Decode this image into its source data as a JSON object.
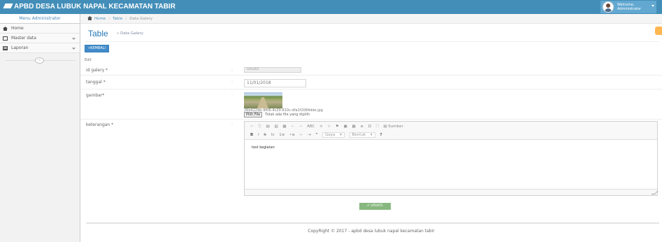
{
  "app": {
    "title": "APBD DESA LUBUK NAPAL KECAMATAN TABIR",
    "user": {
      "welcome": "Welcome,",
      "name": "Administrator"
    }
  },
  "sidebar": {
    "header": "Menu Administrator",
    "items": [
      {
        "label": "Home",
        "icon": "home-icon",
        "has_children": false
      },
      {
        "label": "Master data",
        "icon": "edit-icon",
        "has_children": true
      },
      {
        "label": "Laporan",
        "icon": "table-icon",
        "has_children": true
      }
    ],
    "collapse_symbol": "«"
  },
  "breadcrumb": [
    "Home",
    "Table",
    "Data Galery"
  ],
  "page": {
    "title": "Table",
    "subtitle": "» Data Galery",
    "back_button": "KEMBALI",
    "section_label": "Edit"
  },
  "form": {
    "id_label": "id galery *",
    "id_value": "GAL001",
    "date_label": "tanggal *",
    "date_value": "11/01/2018",
    "image_label": "gambar*",
    "image_filename": "26b4229b-9f06-4c20-810c-dfa1f2084dde.jpg",
    "file_button": "Pilih File",
    "file_status": "Tidak ada file yang dipilih",
    "desc_label": "keterangan *",
    "desc_value": "test kegiatan",
    "colon": ":",
    "update_button": "UPDATE"
  },
  "editor": {
    "toolbar_row1": [
      "✂",
      "⎘",
      "▤",
      "▥",
      "▦",
      "←",
      "→",
      "ABC",
      "∞",
      "⊘",
      "⚑",
      "▣",
      "▦",
      "≡",
      "Ω",
      "⛶",
      "▤ Sumber"
    ],
    "toolbar_row2_left": [
      "B",
      "I",
      "S",
      "Ix",
      "1≡",
      "•≡",
      "⇤",
      "⇥",
      "❞"
    ],
    "style_select": "Gaya",
    "format_select": "Bentuk",
    "help": "?"
  },
  "footer": {
    "text": "CopyRight © 2017 - apbd desa lubuk napal kecamatan tabir"
  },
  "colors": {
    "navbar": "#438eb9",
    "primary": "#428bca",
    "success": "#87b87f",
    "accent": "#ffb752"
  }
}
